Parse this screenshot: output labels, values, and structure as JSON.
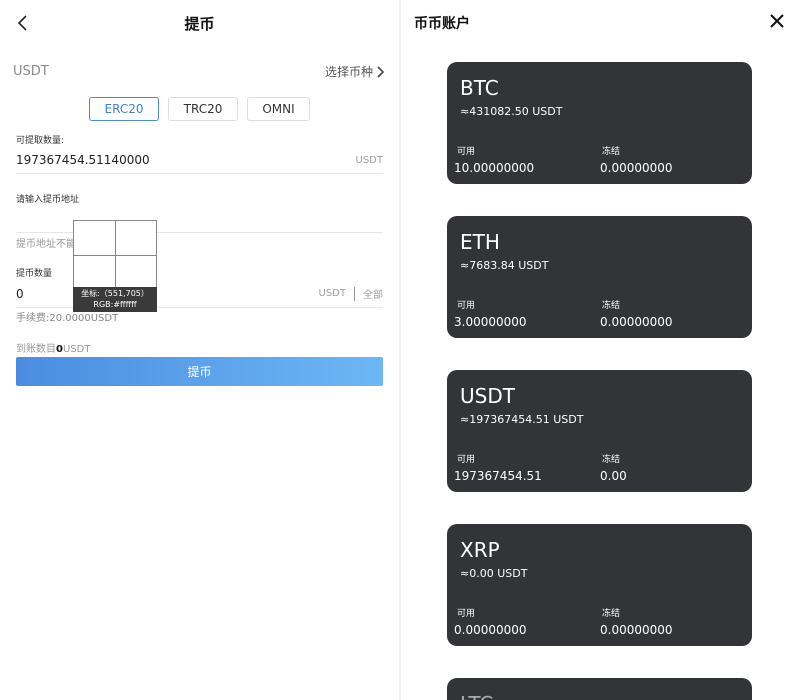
{
  "withdraw": {
    "title": "提币",
    "coin": "USDT",
    "select_coin": "选择币种",
    "chains": [
      {
        "label": "ERC20",
        "active": true
      },
      {
        "label": "TRC20",
        "active": false
      },
      {
        "label": "OMNI",
        "active": false
      }
    ],
    "available_label": "可提取数量:",
    "available_value": "197367454.51140000",
    "unit": "USDT",
    "address_label": "请输入提币地址",
    "address_value": "",
    "address_hint": "提币地址不能",
    "amount_label": "提币数量",
    "amount_value": "0",
    "all_label": "全部",
    "fee_text": "手续费:20.0000USDT",
    "received_prefix": "到账数目",
    "received_value": "0",
    "received_unit": "USDT",
    "submit_label": "提币"
  },
  "probe": {
    "coord_text": "坐标:（551,705）",
    "rgb_text": "RGB:#ffffff"
  },
  "accounts": {
    "title": "币币账户",
    "available_label": "可用",
    "frozen_label": "冻结",
    "cards": [
      {
        "name": "BTC",
        "equiv": "≈431082.50 USDT",
        "available": "10.00000000",
        "frozen": "0.00000000"
      },
      {
        "name": "ETH",
        "equiv": "≈7683.84 USDT",
        "available": "3.00000000",
        "frozen": "0.00000000"
      },
      {
        "name": "USDT",
        "equiv": "≈197367454.51 USDT",
        "available": "197367454.51",
        "frozen": "0.00"
      },
      {
        "name": "XRP",
        "equiv": "≈0.00 USDT",
        "available": "0.00000000",
        "frozen": "0.00000000"
      },
      {
        "name": "LTC",
        "equiv": "",
        "available": "",
        "frozen": ""
      }
    ]
  }
}
